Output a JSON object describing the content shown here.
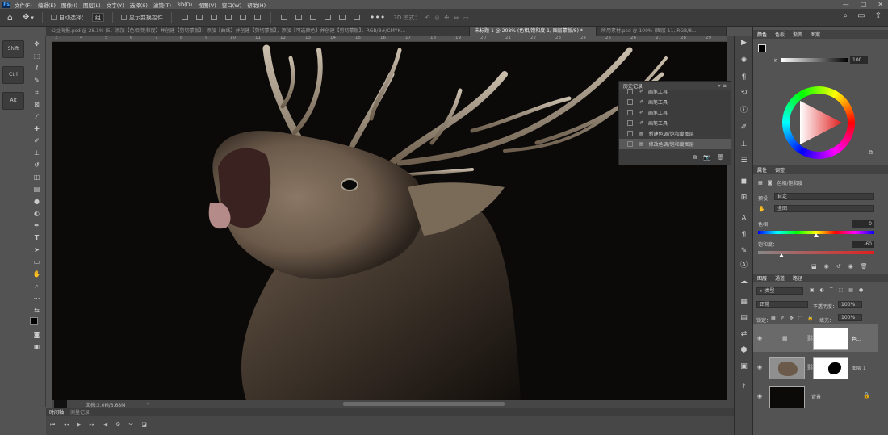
{
  "menu": {
    "app_logo": "Ps",
    "items": [
      "文件(F)",
      "编辑(E)",
      "图像(I)",
      "图层(L)",
      "文字(Y)",
      "选择(S)",
      "滤镜(T)",
      "3D(D)",
      "视图(V)",
      "窗口(W)",
      "帮助(H)"
    ]
  },
  "window_controls": [
    "—",
    "□",
    "✕"
  ],
  "options_bar": {
    "auto_select_label": "自动选择：",
    "auto_select_value": "组",
    "show_transform_label": "显示变换控件",
    "mode_3d_label": "3D 模式："
  },
  "tabs": [
    {
      "label": "公益海报.psd @ 28.1% (5、添加【色相/饱和度】并创建【剪切蒙版】：添加【曲线】并创建【剪切蒙版】，添加【可选颜色】并创建【剪切蒙版】，RGB/8#/CMYK...",
      "active": false
    },
    {
      "label": "未标题-1 @ 208% (色相/饱和度 1, 图层蒙版/8) *",
      "active": true
    },
    {
      "label": "所用素材.psd @ 100% (图层 11, RGB/8...",
      "active": false
    }
  ],
  "shortcuts": [
    "Shift",
    "Ctrl",
    "Alt"
  ],
  "ruler_top_ticks": [
    "3",
    "4",
    "5",
    "6",
    "7",
    "8",
    "9",
    "10",
    "11",
    "12",
    "13",
    "14",
    "15",
    "16",
    "17",
    "18",
    "19",
    "20",
    "21",
    "22",
    "23",
    "24",
    "25",
    "26",
    "27",
    "28",
    "29"
  ],
  "status": {
    "doc": "文档:2.0M/3.68M"
  },
  "timeline": {
    "tabs": [
      "时间轴",
      "测量记录"
    ]
  },
  "history": {
    "title": "历史记录",
    "items": [
      {
        "label": "画笔工具",
        "selected": false
      },
      {
        "label": "画笔工具",
        "selected": false
      },
      {
        "label": "画笔工具",
        "selected": false
      },
      {
        "label": "画笔工具",
        "selected": false
      },
      {
        "label": "新建色调/饱和度图层",
        "selected": false
      },
      {
        "label": "修改色调/饱和度图层",
        "selected": true
      }
    ]
  },
  "color_panel": {
    "tabs": [
      "颜色",
      "色板",
      "渐变",
      "图案"
    ],
    "k_label": "K",
    "k_value": "100"
  },
  "properties": {
    "tabs": [
      "属性",
      "调整"
    ],
    "title": "色相/饱和度",
    "preset_label": "预设：",
    "preset_value": "自定",
    "channel_value": "全图",
    "hue_label": "色相：",
    "hue_value": "0",
    "sat_label": "饱和度：",
    "sat_value": "-60",
    "light_label": "明度：",
    "light_value": "0",
    "hue_fraction": 0.5,
    "sat_fraction": 0.2
  },
  "layers": {
    "tabs": [
      "图层",
      "通道",
      "路径"
    ],
    "filter_label": "类型",
    "blend_mode": "正常",
    "opacity_label": "不透明度：",
    "opacity_value": "100%",
    "lock_label": "锁定：",
    "fill_label": "填充：",
    "fill_value": "100%",
    "items": [
      {
        "name": "色...",
        "selected": true
      },
      {
        "name": "图层 1",
        "selected": false
      },
      {
        "name": "背景",
        "selected": false
      }
    ]
  },
  "colors": {
    "menubar": "#535353",
    "panel": "#535353",
    "dark_panel": "#3c3c3c",
    "canvas": "#0c0a09",
    "selection": "#585858"
  }
}
